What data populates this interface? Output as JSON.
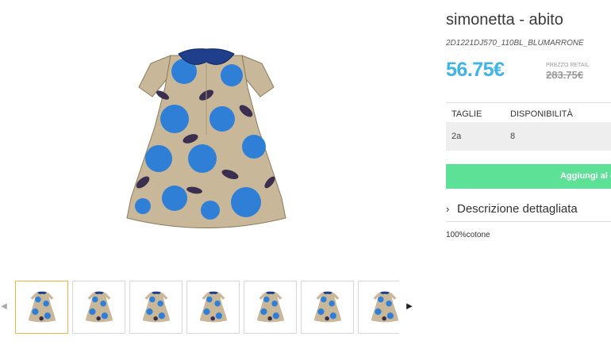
{
  "product": {
    "title": "simonetta - abito",
    "sku": "2D1221DJ570_110BL_BLUMARRONE",
    "price": "56.75€",
    "retail_label": "PREZZO RETAIL",
    "retail_price": "283.75€"
  },
  "stock_table": {
    "headers": [
      "TAGLIE",
      "DISPONIBILITÀ"
    ],
    "rows": [
      {
        "size": "2a",
        "availability": "8"
      }
    ]
  },
  "add_to_cart_label": "Aggiungi al carrello",
  "description": {
    "toggle_label": "Descrizione dettagliata",
    "text": "100%cotone"
  },
  "gallery": {
    "thumbnail_count": 7,
    "active_index": 0
  },
  "colors": {
    "price": "#3fb4e8",
    "add_button": "#5ce196",
    "active_thumb_border": "#f0b24a",
    "dress_blue": "#2f7fd6",
    "dress_beige": "#c9b79a",
    "collar_navy": "#1f3f8c"
  }
}
